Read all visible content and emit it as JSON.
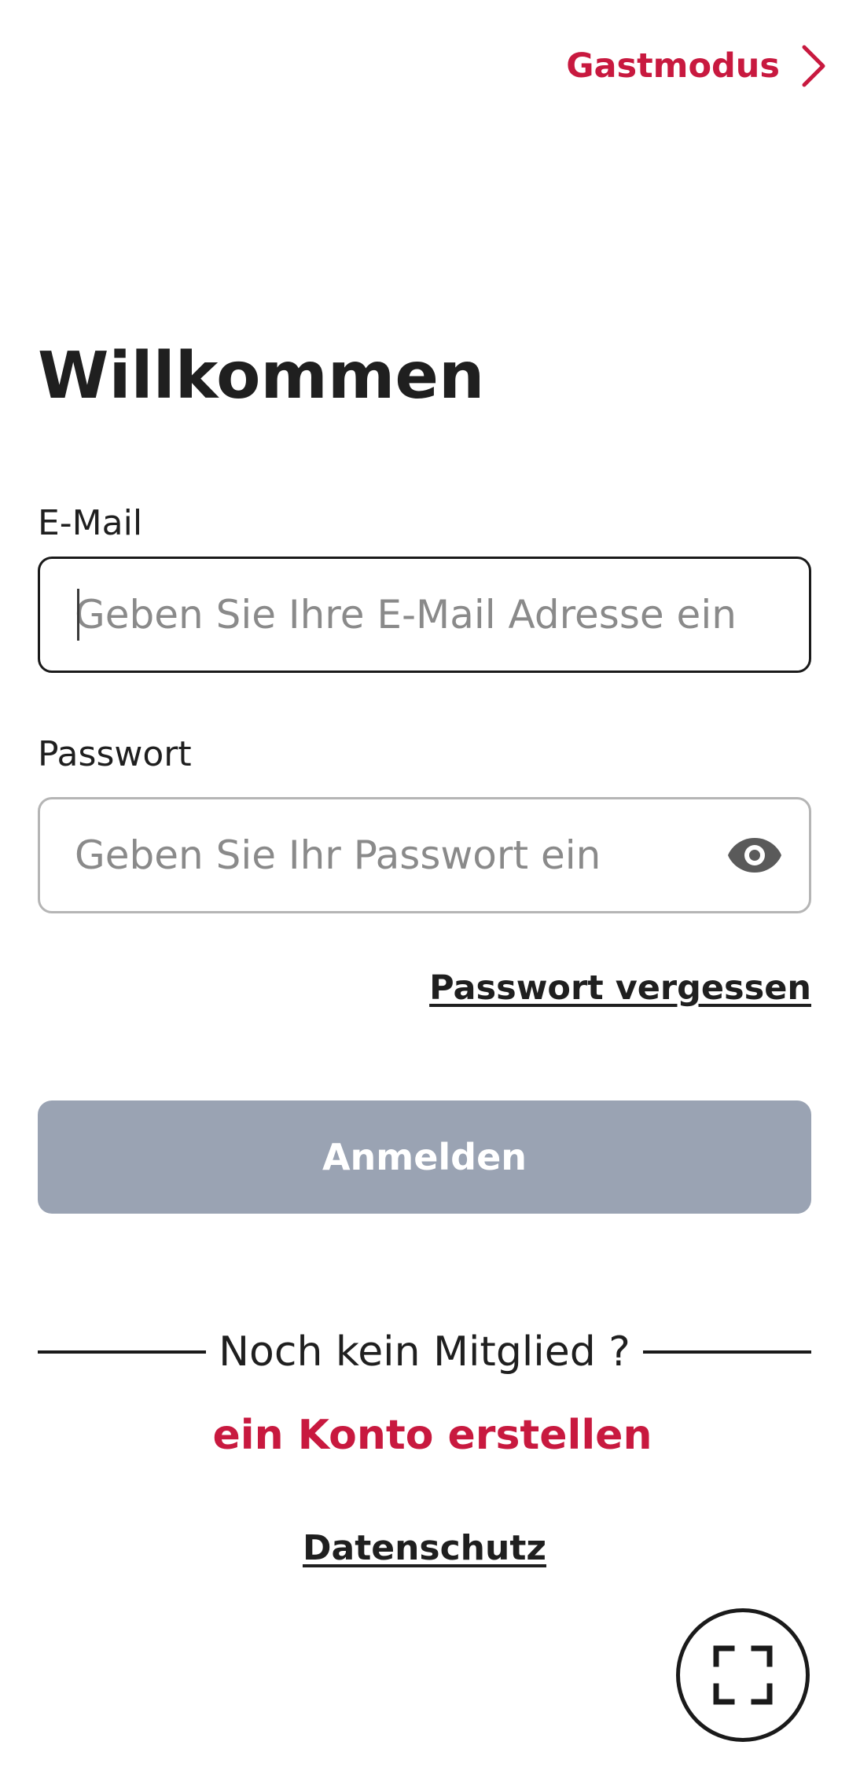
{
  "header": {
    "guest_mode_label": "Gastmodus",
    "guest_mode_icon": "chevron-right-icon"
  },
  "title": "Willkommen",
  "email": {
    "label": "E-Mail",
    "value": "",
    "placeholder": "Geben Sie Ihre E-Mail Adresse ein"
  },
  "password": {
    "label": "Passwort",
    "value": "",
    "placeholder": "Geben Sie Ihr Passwort ein",
    "toggle_icon": "eye-icon"
  },
  "forgot_password_label": "Passwort vergessen",
  "login_button_label": "Anmelden",
  "divider_text": "Noch kein Mitglied ?",
  "create_account_label": "ein Konto erstellen",
  "privacy_label": "Datenschutz",
  "fullscreen_icon": "fullscreen-icon",
  "colors": {
    "accent": "#c8193f",
    "text": "#1f1f1f",
    "button_disabled": "#9aa3b3",
    "input_border_active": "#1a1a1a",
    "input_border_inactive": "#b5b5b5",
    "placeholder": "#8a8a8a"
  }
}
